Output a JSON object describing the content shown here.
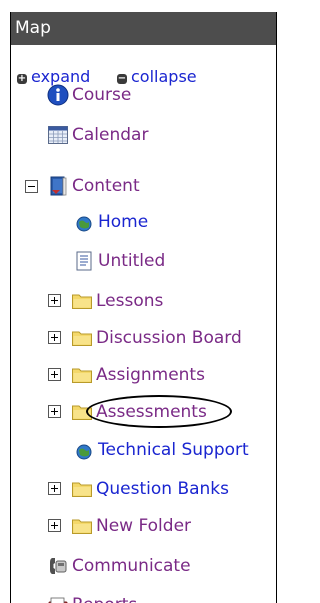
{
  "header": {
    "title": "Map"
  },
  "controls": {
    "expand": "expand",
    "collapse": "collapse"
  },
  "tree": {
    "course": "Course",
    "calendar": "Calendar",
    "content": "Content",
    "home": "Home",
    "untitled": "Untitled",
    "lessons": "Lessons",
    "discussion_board": "Discussion Board",
    "assignments": "Assignments",
    "assessments": "Assessments",
    "technical_support": "Technical Support",
    "question_banks": "Question Banks",
    "new_folder": "New Folder",
    "communicate": "Communicate",
    "reports": "Reports"
  },
  "colors": {
    "header_bg": "#4d4d4d",
    "link_blue": "#1a25d0",
    "link_purple": "#7a2a86",
    "folder_yellow": "#f4d86a"
  }
}
